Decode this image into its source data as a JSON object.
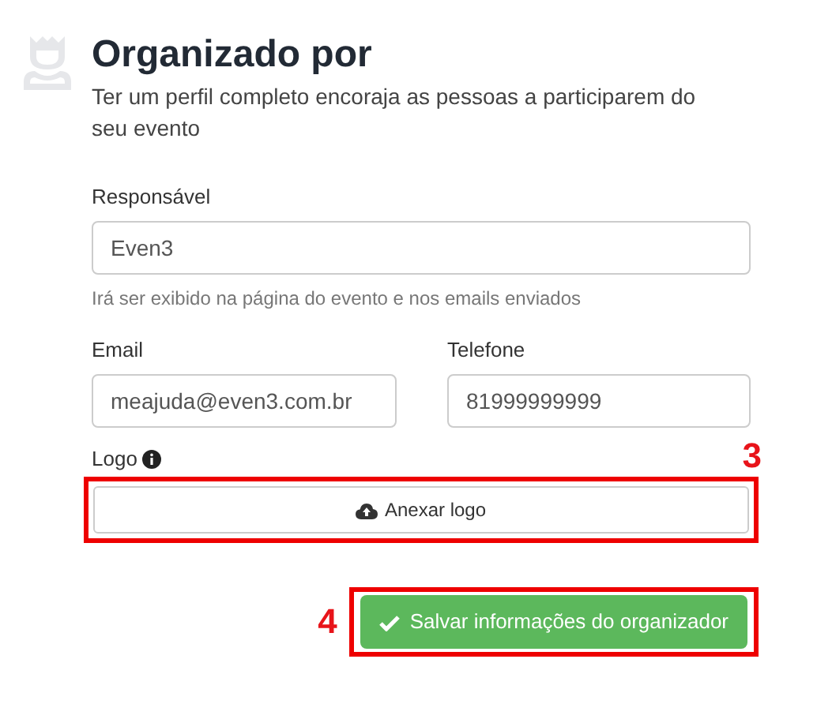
{
  "header": {
    "title": "Organizado por",
    "subtitle": "Ter um perfil completo encoraja as pessoas a participarem do seu evento"
  },
  "responsible": {
    "label": "Responsável",
    "value": "Even3",
    "help": "Irá ser exibido na página do evento e nos emails enviados"
  },
  "email": {
    "label": "Email",
    "value": "meajuda@even3.com.br"
  },
  "phone": {
    "label": "Telefone",
    "value": "81999999999"
  },
  "logo": {
    "label": "Logo",
    "button": "Anexar logo",
    "annotation": "3"
  },
  "save": {
    "button": "Salvar informações do organizador",
    "annotation": "4"
  }
}
